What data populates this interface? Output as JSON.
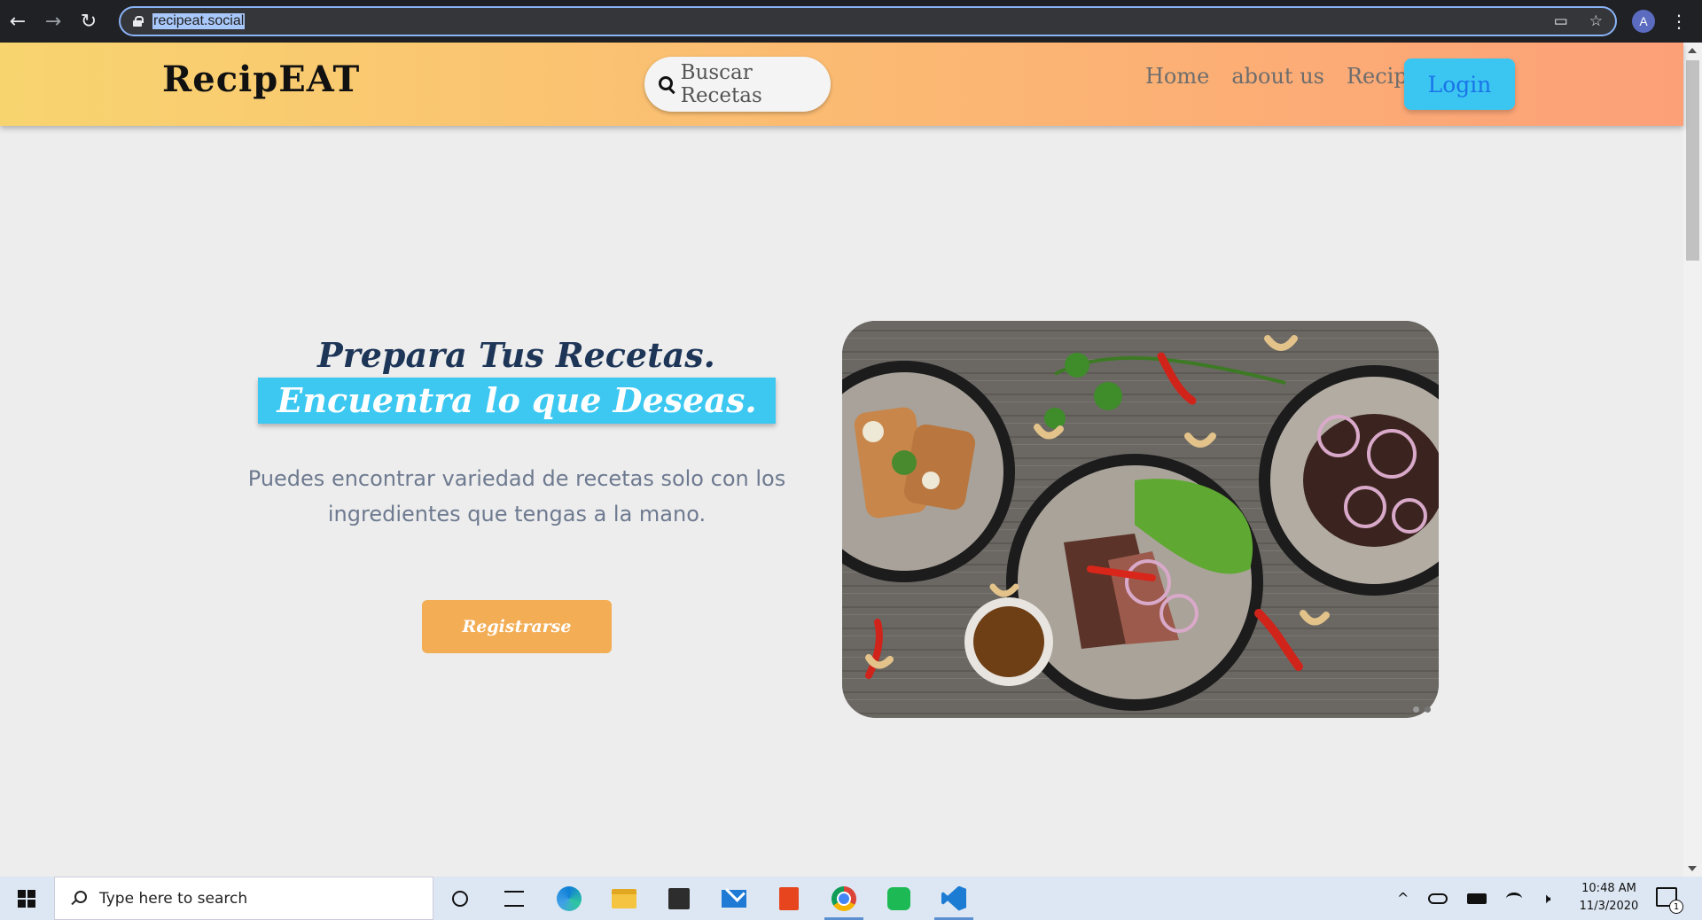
{
  "browser": {
    "url": "recipeat.social",
    "back_glyph": "←",
    "forward_glyph": "→",
    "reload_glyph": "↻",
    "cast_glyph": "▭",
    "star_glyph": "☆",
    "avatar_initial": "A",
    "menu_glyph": "⋮"
  },
  "header": {
    "logo": "RecipEAT",
    "search_label": "Buscar Recetas",
    "nav": [
      "Home",
      "about us",
      "Recipe"
    ],
    "login_label": "Login"
  },
  "hero": {
    "title_line_1": "Prepara Tus Recetas.",
    "title_line_2": "Encuentra lo que Deseas.",
    "description": "Puedes encontrar variedad de recetas solo con los ingredientes que tengas a la mano.",
    "register_label": "Registrarse"
  },
  "carousel": {
    "dot_count": 2,
    "active_index": 1
  },
  "taskbar": {
    "search_placeholder": "Type here to search",
    "icons": [
      "cortana-icon",
      "task-view-icon",
      "edge-icon",
      "file-explorer-icon",
      "store-icon",
      "mail-icon",
      "office-icon",
      "chrome-icon",
      "spotify-icon",
      "vscode-icon"
    ],
    "time": "10:48 AM",
    "date": "11/3/2020",
    "notification_count": "1",
    "tray_up_glyph": "^",
    "tray_mute_glyph": "🕨"
  },
  "colors": {
    "header_gradient_start": "#f8d46f",
    "header_gradient_end": "#fca078",
    "title_dark": "#1d3557",
    "title_highlight": "#3cc8f1",
    "login_bg": "#3bc6f2",
    "register_bg": "#f3ad55"
  }
}
